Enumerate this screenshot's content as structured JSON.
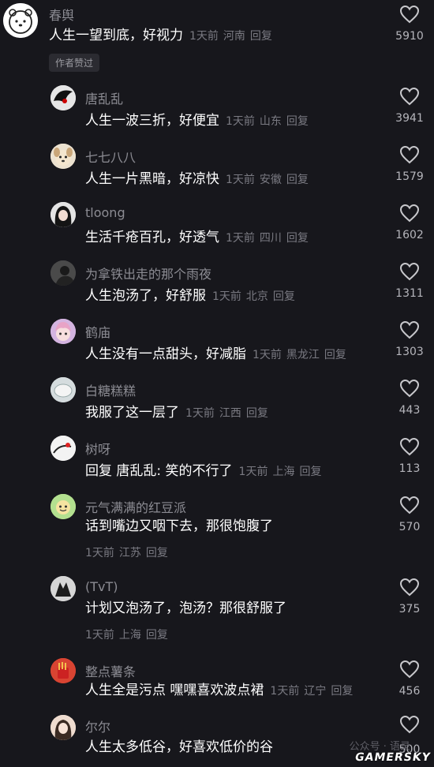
{
  "author_badge": "作者赞过",
  "watermark": "GAMERSKY",
  "faint_watermark": "公众号 · 语录",
  "comments": [
    {
      "user": "春舆",
      "text": "人生一望到底，好视力",
      "time": "1天前",
      "region": "河南",
      "reply": "回复",
      "likes": "5910"
    },
    {
      "user": "唐乱乱",
      "text": "人生一波三折，好便宜",
      "time": "1天前",
      "region": "山东",
      "reply": "回复",
      "likes": "3941"
    },
    {
      "user": "七七八八",
      "text": "人生一片黑暗，好凉快",
      "time": "1天前",
      "region": "安徽",
      "reply": "回复",
      "likes": "1579"
    },
    {
      "user": "tloong",
      "text": "生活千疮百孔，好透气",
      "time": "1天前",
      "region": "四川",
      "reply": "回复",
      "likes": "1602"
    },
    {
      "user": "为拿铁出走的那个雨夜",
      "text": "人生泡汤了，好舒服",
      "time": "1天前",
      "region": "北京",
      "reply": "回复",
      "likes": "1311"
    },
    {
      "user": "鹤庙",
      "text": "人生没有一点甜头，好减脂",
      "time": "1天前",
      "region": "黑龙江",
      "reply": "回复",
      "likes": "1303"
    },
    {
      "user": "白糖糕糕",
      "text": "我服了这一层了",
      "time": "1天前",
      "region": "江西",
      "reply": "回复",
      "likes": "443"
    },
    {
      "user": "树呀",
      "text": "回复 唐乱乱: 笑的不行了",
      "time": "1天前",
      "region": "上海",
      "reply": "回复",
      "likes": "113"
    },
    {
      "user": "元气满满的红豆派",
      "text": "话到嘴边又咽下去，那很饱腹了",
      "time": "1天前",
      "region": "江苏",
      "reply": "回复",
      "likes": "570"
    },
    {
      "user": "(TvT)",
      "text": "计划又泡汤了，泡汤？那很舒服了",
      "time": "1天前",
      "region": "上海",
      "reply": "回复",
      "likes": "375"
    },
    {
      "user": "整点薯条",
      "text": "人生全是污点 嘿嘿喜欢波点裙",
      "time": "1天前",
      "region": "辽宁",
      "reply": "回复",
      "likes": "456"
    },
    {
      "user": "尔尔",
      "text": "人生太多低谷，好喜欢低价的谷",
      "time": "",
      "region": "",
      "reply": "",
      "likes": "500"
    }
  ]
}
